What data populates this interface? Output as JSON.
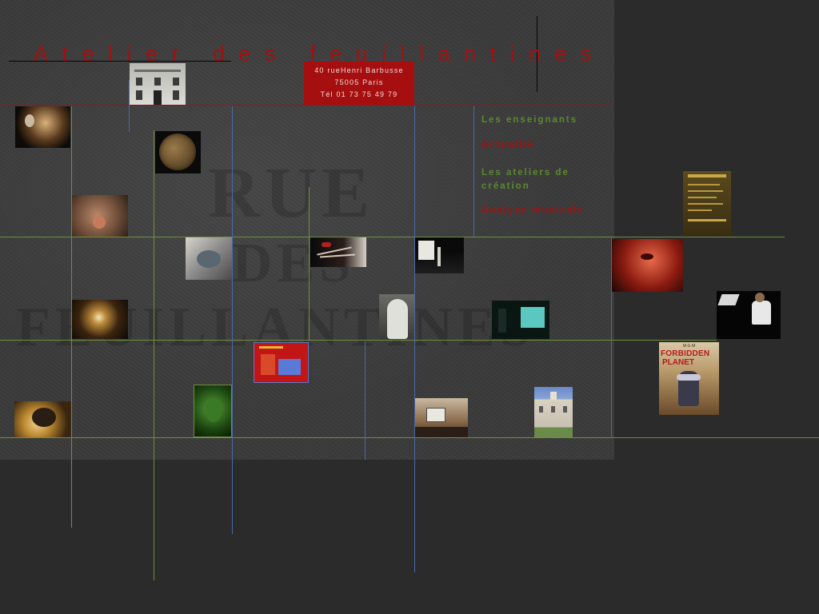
{
  "site": {
    "title": "Atelier des feuillantines"
  },
  "address": {
    "street": "40 rueHenri Barbusse",
    "city": "75005 Paris",
    "phone": "Tél 01 73 75 49 79"
  },
  "nav": {
    "items": [
      {
        "label": "Les enseignants",
        "color": "#5a8a2e"
      },
      {
        "label": "Actualité",
        "color": "#a01212"
      },
      {
        "label": "Les ateliers de création",
        "color": "#5a8a2e"
      },
      {
        "label": "Analyse musicale",
        "color": "#a01212"
      }
    ]
  },
  "poster_forbidden_planet": {
    "studio": "M·G·M",
    "title_line1": "FORBIDDEN",
    "title_line2": "PLANET"
  },
  "colors": {
    "background": "#2b2b2b",
    "texture": "#3a3a3a",
    "accent_red": "#a50f0f",
    "line_green": "#6f8f3e",
    "line_blue": "#4a6aa8",
    "line_red": "#8a1a1a"
  }
}
